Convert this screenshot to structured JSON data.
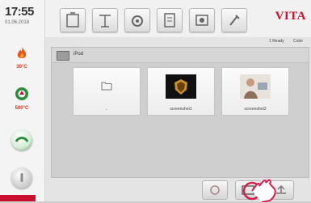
{
  "status": {
    "time": "17:55",
    "date": "01.06.2018",
    "temp_label": "30°C",
    "vacuum_label": "500°C"
  },
  "brand": "VITA",
  "header": {
    "status_left": "1 Ready",
    "status_right": "Color"
  },
  "browser": {
    "path_label": "iPod",
    "files": [
      {
        "name": "..",
        "type": "folder"
      },
      {
        "name": "screenshot1",
        "type": "image"
      },
      {
        "name": "screenshot2",
        "type": "image"
      }
    ]
  },
  "colors": {
    "brand": "#c8102e",
    "flame": "#e8541a",
    "vacuum": "#2e8b3a"
  }
}
